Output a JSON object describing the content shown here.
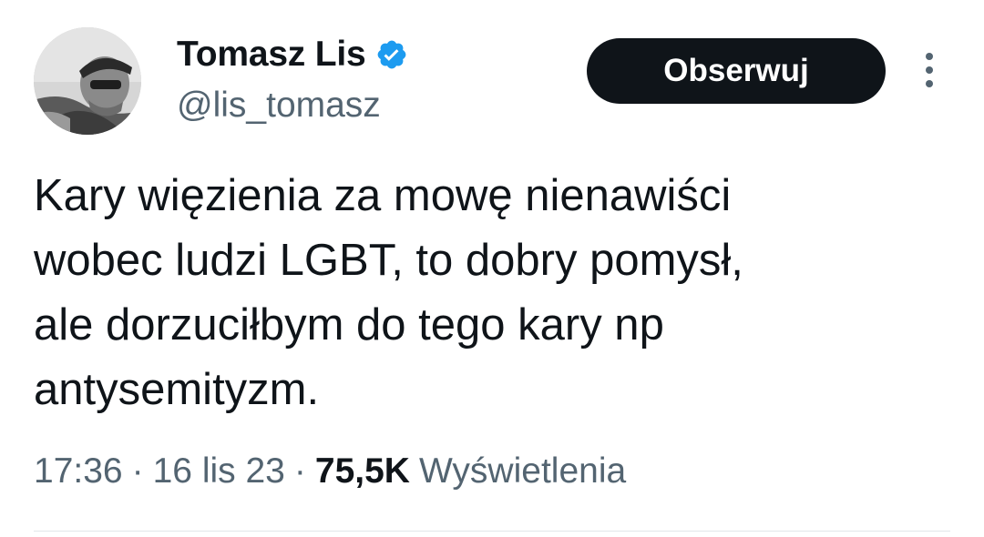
{
  "author": {
    "display_name": "Tomasz Lis",
    "handle": "@lis_tomasz",
    "verified": true,
    "verified_color": "#1d9bf0"
  },
  "actions": {
    "follow_label": "Obserwuj",
    "more_icon": "more-vertical-icon"
  },
  "tweet": {
    "lines": [
      "Kary więzienia za mowę nienawiści",
      "wobec ludzi LGBT, to dobry pomysł,",
      "ale dorzuciłbym do tego kary np",
      "antysemityzm."
    ]
  },
  "meta": {
    "time": "17:36",
    "separator": "·",
    "date": "16 lis 23",
    "views_count": "75,5K",
    "views_label": "Wyświetlenia"
  },
  "colors": {
    "text_primary": "#0f1419",
    "text_secondary": "#536471",
    "button_bg": "#0f1419",
    "button_text": "#ffffff",
    "divider": "#e1e6ea"
  }
}
